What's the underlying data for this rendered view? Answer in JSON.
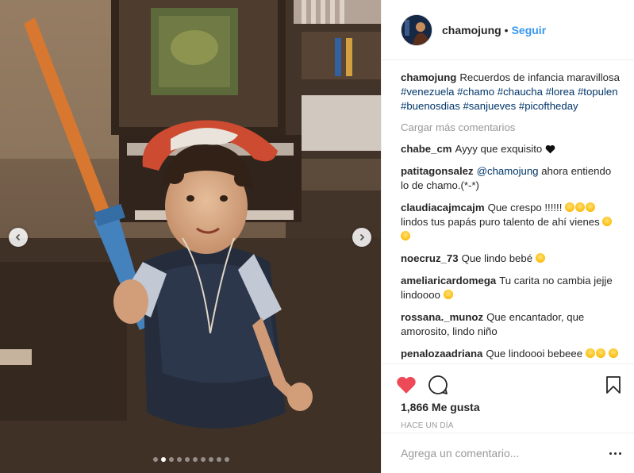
{
  "post": {
    "username": "chamojung",
    "separator": "•",
    "follow_label": "Seguir",
    "caption_user": "chamojung",
    "caption_text": "Recuerdos de infancia maravillosa",
    "hashtags": [
      "#venezuela",
      "#chamo",
      "#chaucha",
      "#lorea",
      "#topulen",
      "#buenosdias",
      "#sanjueves",
      "#picoftheday"
    ],
    "load_more": "Cargar más comentarios",
    "comments": [
      {
        "user": "chabe_cm",
        "text": "Ayyy que exquisito",
        "emoji": "black-heart"
      },
      {
        "user": "patitagonsalez",
        "mention": "@chamojung",
        "text": "ahora entiendo lo de chamo.(*-*)"
      },
      {
        "user": "claudiacajmcajm",
        "text": "Que crespo !!!!!!",
        "emoji_count": 3,
        "text2": "lindos tus papás puro talento de ahí vienes",
        "emoji2_count": 2
      },
      {
        "user": "noecruz_73",
        "text": "Que lindo bebé",
        "emoji_count": 1
      },
      {
        "user": "ameliaricardomega",
        "text": "Tu carita no cambia jejje lindoooo",
        "emoji_count": 1
      },
      {
        "user": "rossana._munoz",
        "text": "Que encantador, que amorosito, lindo niño"
      },
      {
        "user": "penalozaadriana",
        "text": "Que lindoooi bebeee",
        "emoji_count": 2,
        "emoji2_count": 4
      }
    ],
    "likes": "1,866 Me gusta",
    "timestamp": "HACE UN DÍA",
    "comment_placeholder": "Agrega un comentario...",
    "carousel": {
      "total": 10,
      "active": 1
    },
    "colors": {
      "link": "#003569",
      "follow": "#3897f0",
      "like": "#ed4956",
      "muted": "#999999"
    }
  }
}
